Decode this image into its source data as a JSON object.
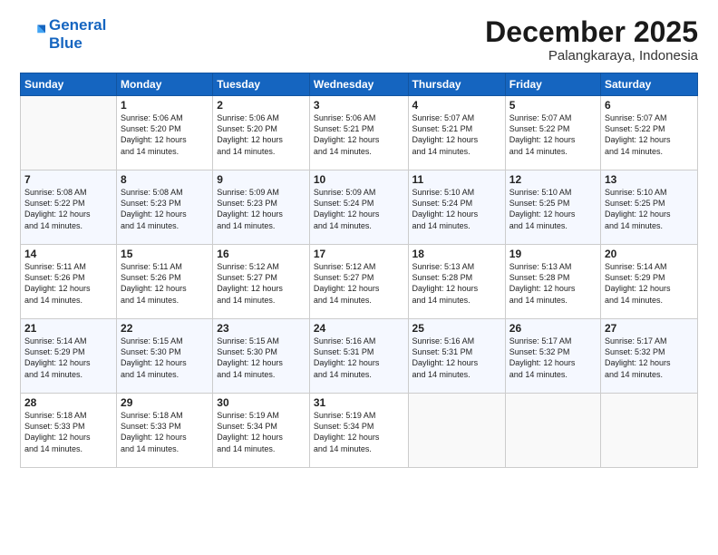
{
  "logo": {
    "line1": "General",
    "line2": "Blue"
  },
  "title": "December 2025",
  "subtitle": "Palangkaraya, Indonesia",
  "days_of_week": [
    "Sunday",
    "Monday",
    "Tuesday",
    "Wednesday",
    "Thursday",
    "Friday",
    "Saturday"
  ],
  "weeks": [
    [
      {
        "num": "",
        "info": ""
      },
      {
        "num": "1",
        "info": "Sunrise: 5:06 AM\nSunset: 5:20 PM\nDaylight: 12 hours\nand 14 minutes."
      },
      {
        "num": "2",
        "info": "Sunrise: 5:06 AM\nSunset: 5:20 PM\nDaylight: 12 hours\nand 14 minutes."
      },
      {
        "num": "3",
        "info": "Sunrise: 5:06 AM\nSunset: 5:21 PM\nDaylight: 12 hours\nand 14 minutes."
      },
      {
        "num": "4",
        "info": "Sunrise: 5:07 AM\nSunset: 5:21 PM\nDaylight: 12 hours\nand 14 minutes."
      },
      {
        "num": "5",
        "info": "Sunrise: 5:07 AM\nSunset: 5:22 PM\nDaylight: 12 hours\nand 14 minutes."
      },
      {
        "num": "6",
        "info": "Sunrise: 5:07 AM\nSunset: 5:22 PM\nDaylight: 12 hours\nand 14 minutes."
      }
    ],
    [
      {
        "num": "7",
        "info": "Sunrise: 5:08 AM\nSunset: 5:22 PM\nDaylight: 12 hours\nand 14 minutes."
      },
      {
        "num": "8",
        "info": "Sunrise: 5:08 AM\nSunset: 5:23 PM\nDaylight: 12 hours\nand 14 minutes."
      },
      {
        "num": "9",
        "info": "Sunrise: 5:09 AM\nSunset: 5:23 PM\nDaylight: 12 hours\nand 14 minutes."
      },
      {
        "num": "10",
        "info": "Sunrise: 5:09 AM\nSunset: 5:24 PM\nDaylight: 12 hours\nand 14 minutes."
      },
      {
        "num": "11",
        "info": "Sunrise: 5:10 AM\nSunset: 5:24 PM\nDaylight: 12 hours\nand 14 minutes."
      },
      {
        "num": "12",
        "info": "Sunrise: 5:10 AM\nSunset: 5:25 PM\nDaylight: 12 hours\nand 14 minutes."
      },
      {
        "num": "13",
        "info": "Sunrise: 5:10 AM\nSunset: 5:25 PM\nDaylight: 12 hours\nand 14 minutes."
      }
    ],
    [
      {
        "num": "14",
        "info": "Sunrise: 5:11 AM\nSunset: 5:26 PM\nDaylight: 12 hours\nand 14 minutes."
      },
      {
        "num": "15",
        "info": "Sunrise: 5:11 AM\nSunset: 5:26 PM\nDaylight: 12 hours\nand 14 minutes."
      },
      {
        "num": "16",
        "info": "Sunrise: 5:12 AM\nSunset: 5:27 PM\nDaylight: 12 hours\nand 14 minutes."
      },
      {
        "num": "17",
        "info": "Sunrise: 5:12 AM\nSunset: 5:27 PM\nDaylight: 12 hours\nand 14 minutes."
      },
      {
        "num": "18",
        "info": "Sunrise: 5:13 AM\nSunset: 5:28 PM\nDaylight: 12 hours\nand 14 minutes."
      },
      {
        "num": "19",
        "info": "Sunrise: 5:13 AM\nSunset: 5:28 PM\nDaylight: 12 hours\nand 14 minutes."
      },
      {
        "num": "20",
        "info": "Sunrise: 5:14 AM\nSunset: 5:29 PM\nDaylight: 12 hours\nand 14 minutes."
      }
    ],
    [
      {
        "num": "21",
        "info": "Sunrise: 5:14 AM\nSunset: 5:29 PM\nDaylight: 12 hours\nand 14 minutes."
      },
      {
        "num": "22",
        "info": "Sunrise: 5:15 AM\nSunset: 5:30 PM\nDaylight: 12 hours\nand 14 minutes."
      },
      {
        "num": "23",
        "info": "Sunrise: 5:15 AM\nSunset: 5:30 PM\nDaylight: 12 hours\nand 14 minutes."
      },
      {
        "num": "24",
        "info": "Sunrise: 5:16 AM\nSunset: 5:31 PM\nDaylight: 12 hours\nand 14 minutes."
      },
      {
        "num": "25",
        "info": "Sunrise: 5:16 AM\nSunset: 5:31 PM\nDaylight: 12 hours\nand 14 minutes."
      },
      {
        "num": "26",
        "info": "Sunrise: 5:17 AM\nSunset: 5:32 PM\nDaylight: 12 hours\nand 14 minutes."
      },
      {
        "num": "27",
        "info": "Sunrise: 5:17 AM\nSunset: 5:32 PM\nDaylight: 12 hours\nand 14 minutes."
      }
    ],
    [
      {
        "num": "28",
        "info": "Sunrise: 5:18 AM\nSunset: 5:33 PM\nDaylight: 12 hours\nand 14 minutes."
      },
      {
        "num": "29",
        "info": "Sunrise: 5:18 AM\nSunset: 5:33 PM\nDaylight: 12 hours\nand 14 minutes."
      },
      {
        "num": "30",
        "info": "Sunrise: 5:19 AM\nSunset: 5:34 PM\nDaylight: 12 hours\nand 14 minutes."
      },
      {
        "num": "31",
        "info": "Sunrise: 5:19 AM\nSunset: 5:34 PM\nDaylight: 12 hours\nand 14 minutes."
      },
      {
        "num": "",
        "info": ""
      },
      {
        "num": "",
        "info": ""
      },
      {
        "num": "",
        "info": ""
      }
    ]
  ]
}
